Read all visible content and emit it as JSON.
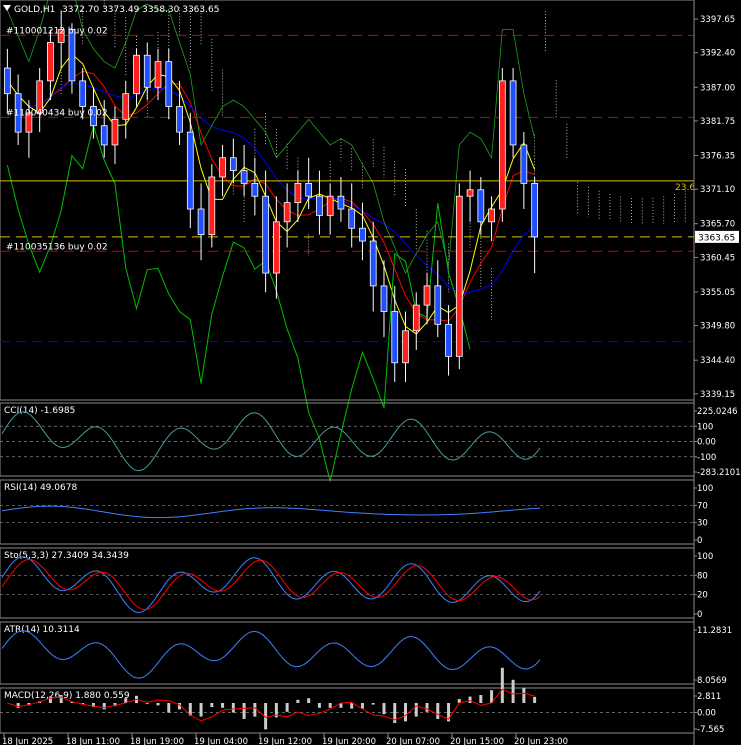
{
  "header": {
    "symbol": "GOLD,H1",
    "ohlc": "3372.70 3373.49 3358.30 3363.65"
  },
  "orders": [
    {
      "label": "#110001212 buy 0.02",
      "price": 3395.1
    },
    {
      "label": "#110040434 buy 0.02",
      "price": 3382.3
    },
    {
      "label": "#110035136 buy 0.02",
      "price": 3361.4
    }
  ],
  "levels": {
    "fib_label": "23.6",
    "fib_price": 3372.4,
    "dash_blue_price": 3347.3,
    "current_price_label": "3363.65",
    "current_price": 3363.65
  },
  "colors": {
    "bull": "#ff2020",
    "bear": "#2050ff",
    "order_line": "#cc0000",
    "fib_line": "#d8c000",
    "blue_line": "#0000ff",
    "tenkan": "#ff0000",
    "kijun": "#0000ff",
    "chikou": "#00c000",
    "ma": "#ffff00",
    "indicator": "#4080ff",
    "signal": "#ff0000"
  },
  "price_axis": [
    "3397.65",
    "3392.40",
    "3387.00",
    "3381.75",
    "3376.35",
    "3371.10",
    "3365.70",
    "3360.45",
    "3355.05",
    "3349.80",
    "3344.40",
    "3339.15"
  ],
  "time_axis": [
    "18 Jun 2025",
    "18 Jun 11:00",
    "18 Jun 19:00",
    "19 Jun 04:00",
    "19 Jun 12:00",
    "19 Jun 20:00",
    "20 Jun 07:00",
    "20 Jun 15:00",
    "20 Jun 23:00"
  ],
  "panels": [
    {
      "name": "cci",
      "title": "CCI(14) -1.6985",
      "scale": [
        "225.0246",
        "100",
        "0.00",
        "-100",
        "-283.2101"
      ]
    },
    {
      "name": "rsi",
      "title": "RSI(14) 49.0678",
      "scale": [
        "100",
        "70",
        "30",
        "0"
      ]
    },
    {
      "name": "stoch",
      "title": "Sto(5,3,3) 27.3409 34.3439",
      "scale": [
        "100",
        "80",
        "20",
        "0"
      ]
    },
    {
      "name": "atr",
      "title": "ATR(14) 10.3114",
      "scale": [
        "11.2831",
        "8.0569"
      ]
    },
    {
      "name": "macd",
      "title": "MACD(12,26,9) 1.880 0.559",
      "scale": [
        "2.811",
        "0.00",
        "-7.565"
      ]
    }
  ],
  "chart_data": {
    "type": "candlestick",
    "timeframe": "H1",
    "ylim": [
      3338.5,
      3400
    ],
    "candles": [
      [
        3390,
        3393,
        3383,
        3386
      ],
      [
        3386,
        3389,
        3378,
        3380
      ],
      [
        3380,
        3385,
        3376,
        3383
      ],
      [
        3383,
        3390,
        3380,
        3388
      ],
      [
        3388,
        3396,
        3385,
        3394
      ],
      [
        3394,
        3399,
        3390,
        3396
      ],
      [
        3396,
        3397,
        3386,
        3388
      ],
      [
        3388,
        3390,
        3382,
        3384
      ],
      [
        3384,
        3387,
        3379,
        3381
      ],
      [
        3381,
        3385,
        3376,
        3378
      ],
      [
        3378,
        3384,
        3375,
        3382
      ],
      [
        3382,
        3388,
        3379,
        3386
      ],
      [
        3386,
        3393,
        3384,
        3392
      ],
      [
        3392,
        3394,
        3385,
        3387
      ],
      [
        3387,
        3393,
        3385,
        3391
      ],
      [
        3391,
        3393,
        3382,
        3384
      ],
      [
        3384,
        3388,
        3378,
        3380
      ],
      [
        3380,
        3383,
        3365,
        3368
      ],
      [
        3368,
        3372,
        3360,
        3364
      ],
      [
        3364,
        3375,
        3362,
        3373
      ],
      [
        3373,
        3378,
        3370,
        3376
      ],
      [
        3376,
        3379,
        3372,
        3374
      ],
      [
        3374,
        3378,
        3370,
        3372
      ],
      [
        3372,
        3376,
        3367,
        3370
      ],
      [
        3370,
        3374,
        3355,
        3358
      ],
      [
        3358,
        3370,
        3354,
        3366
      ],
      [
        3366,
        3372,
        3362,
        3369
      ],
      [
        3369,
        3374,
        3366,
        3372
      ],
      [
        3372,
        3376,
        3368,
        3370
      ],
      [
        3370,
        3374,
        3364,
        3367
      ],
      [
        3367,
        3372,
        3364,
        3370
      ],
      [
        3370,
        3373,
        3366,
        3368
      ],
      [
        3368,
        3372,
        3362,
        3365
      ],
      [
        3365,
        3369,
        3360,
        3363
      ],
      [
        3363,
        3366,
        3352,
        3356
      ],
      [
        3356,
        3360,
        3348,
        3352
      ],
      [
        3352,
        3356,
        3341,
        3344
      ],
      [
        3344,
        3352,
        3341,
        3349
      ],
      [
        3349,
        3355,
        3346,
        3353
      ],
      [
        3353,
        3358,
        3350,
        3356
      ],
      [
        3356,
        3360,
        3348,
        3350
      ],
      [
        3350,
        3353,
        3342,
        3345
      ],
      [
        3345,
        3372,
        3343,
        3370
      ],
      [
        3370,
        3374,
        3366,
        3371
      ],
      [
        3371,
        3373,
        3364,
        3366
      ],
      [
        3366,
        3370,
        3363,
        3368
      ],
      [
        3368,
        3390,
        3366,
        3388
      ],
      [
        3388,
        3390,
        3376,
        3378
      ],
      [
        3378,
        3380,
        3368,
        3372
      ],
      [
        3372,
        3373,
        3358,
        3363.65
      ]
    ]
  }
}
